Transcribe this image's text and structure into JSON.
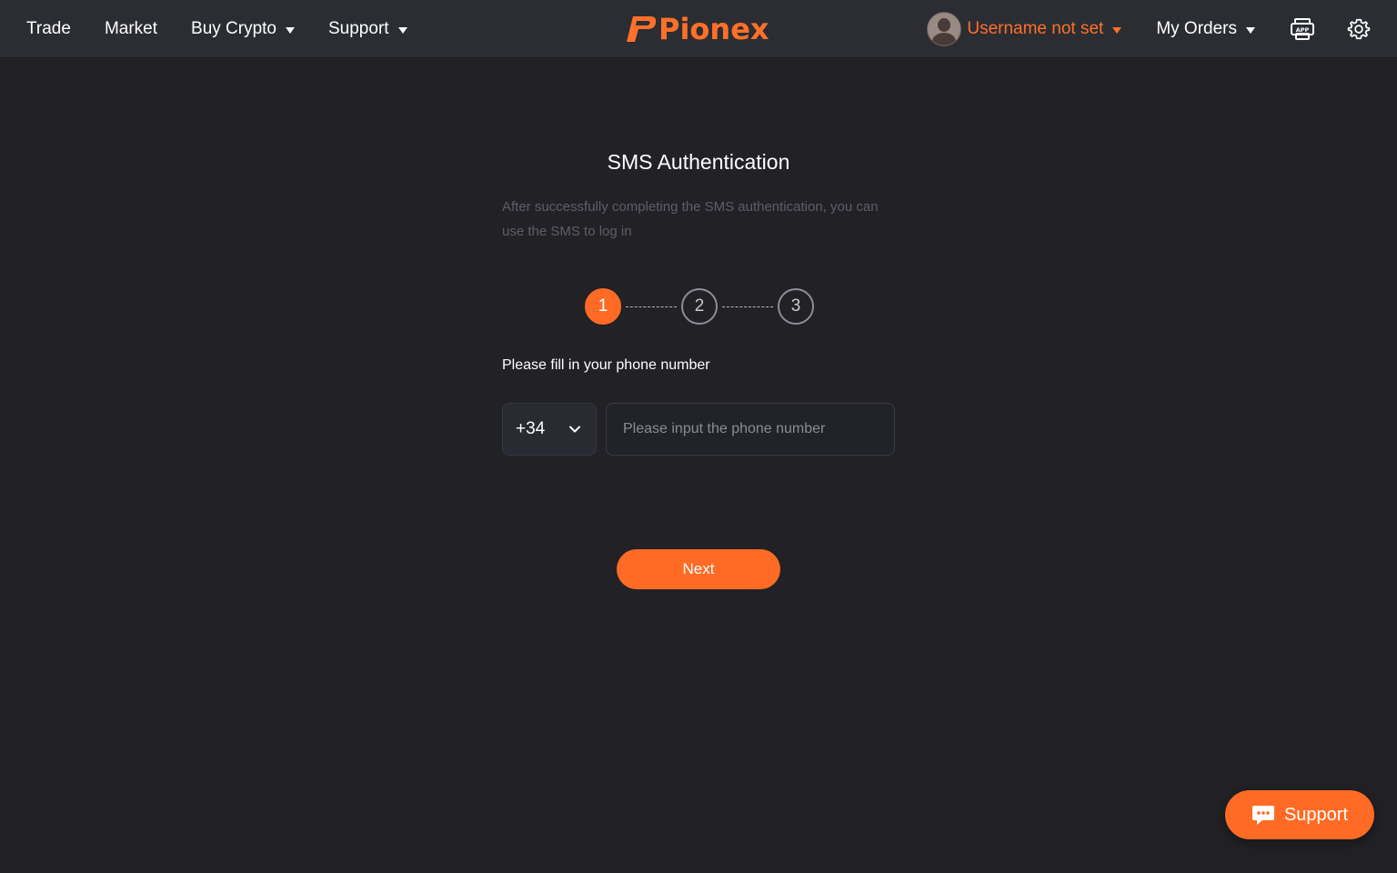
{
  "nav": {
    "trade": "Trade",
    "market": "Market",
    "buy_crypto": "Buy Crypto",
    "support": "Support"
  },
  "brand": {
    "name": "Pionex",
    "accent_color": "#ff7028"
  },
  "user": {
    "name": "Username not set"
  },
  "orders": {
    "label": "My Orders"
  },
  "icons": {
    "app": "app-download-icon",
    "settings": "gear-icon",
    "chat": "chat-icon"
  },
  "app_icon_text": "APP",
  "page": {
    "title": "SMS Authentication",
    "subtitle": "After successfully completing the SMS authentication, you can use the SMS to log in"
  },
  "steps": [
    "1",
    "2",
    "3"
  ],
  "active_step": 1,
  "form": {
    "label": "Please fill in your phone number",
    "country_code": "+34",
    "phone_placeholder": "Please input the phone number",
    "phone_value": ""
  },
  "next_button": "Next",
  "support_fab": "Support"
}
